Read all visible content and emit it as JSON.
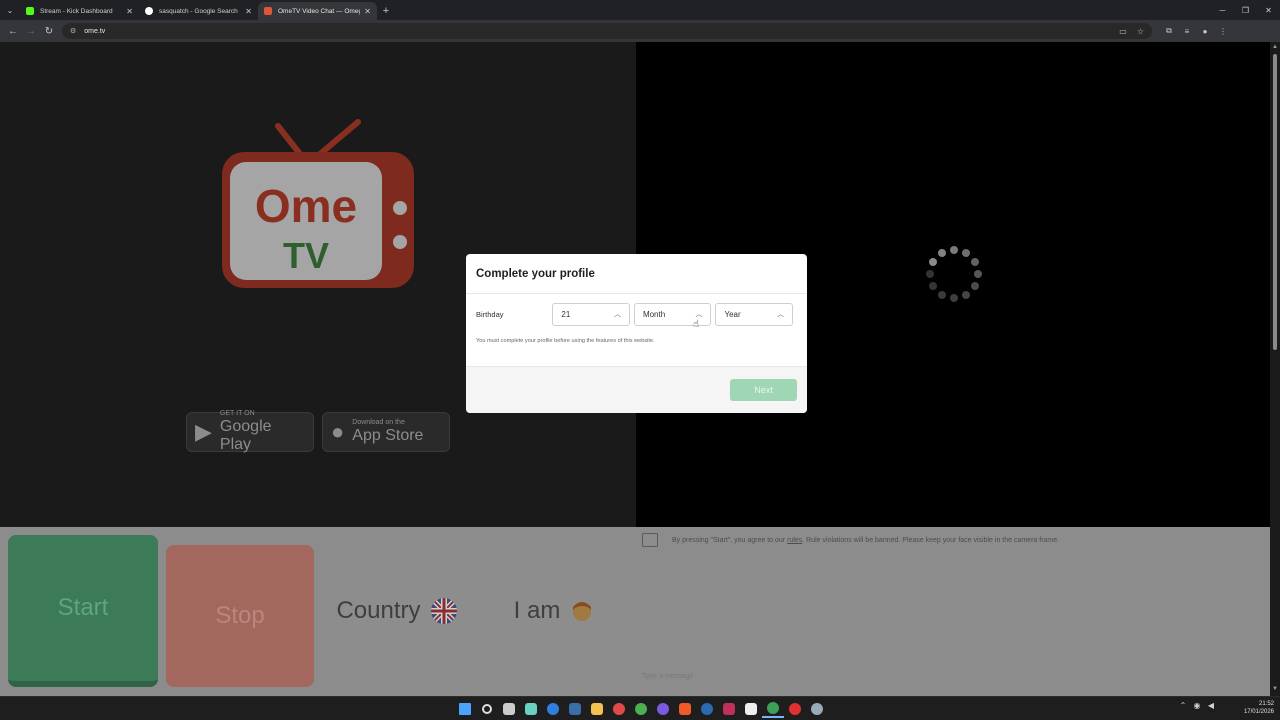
{
  "browser": {
    "tabs": [
      {
        "title": "Stream - Kick Dashboard",
        "favicon_color": "#53fc18",
        "active": false
      },
      {
        "title": "sasquatch - Google Search",
        "favicon_color": "#ffffff",
        "active": false
      },
      {
        "title": "OmeTV Video Chat — Omegle",
        "favicon_color": "#e0563c",
        "active": true
      }
    ],
    "url": "ome.tv"
  },
  "page": {
    "badges": {
      "google_small": "GET IT ON",
      "google_big": "Google Play",
      "apple_small": "Download on the",
      "apple_big": "App Store"
    },
    "buttons": {
      "start": "Start",
      "stop": "Stop",
      "country": "Country",
      "iam": "I am"
    },
    "chat": {
      "note_pre": "By pressing \"Start\", you agree to our ",
      "note_link": "rules",
      "note_post": ". Rule violations will be banned. Please keep your face visible in the camera frame.",
      "input_placeholder": "Type a message"
    }
  },
  "dialog": {
    "title": "Complete your profile",
    "birthday_label": "Birthday",
    "day_value": "21",
    "month_value": "Month",
    "year_value": "Year",
    "note": "You must complete your profile before using the features of this website.",
    "next_label": "Next"
  },
  "taskbar": {
    "time": "21:52",
    "date": "17/01/2026",
    "accent": "#7ab3ff"
  },
  "colors": {
    "brand_red": "#c8402a",
    "brand_green": "#3e7d3e",
    "start_green": "#3c7a58",
    "next_disabled": "#9fd6b3"
  }
}
